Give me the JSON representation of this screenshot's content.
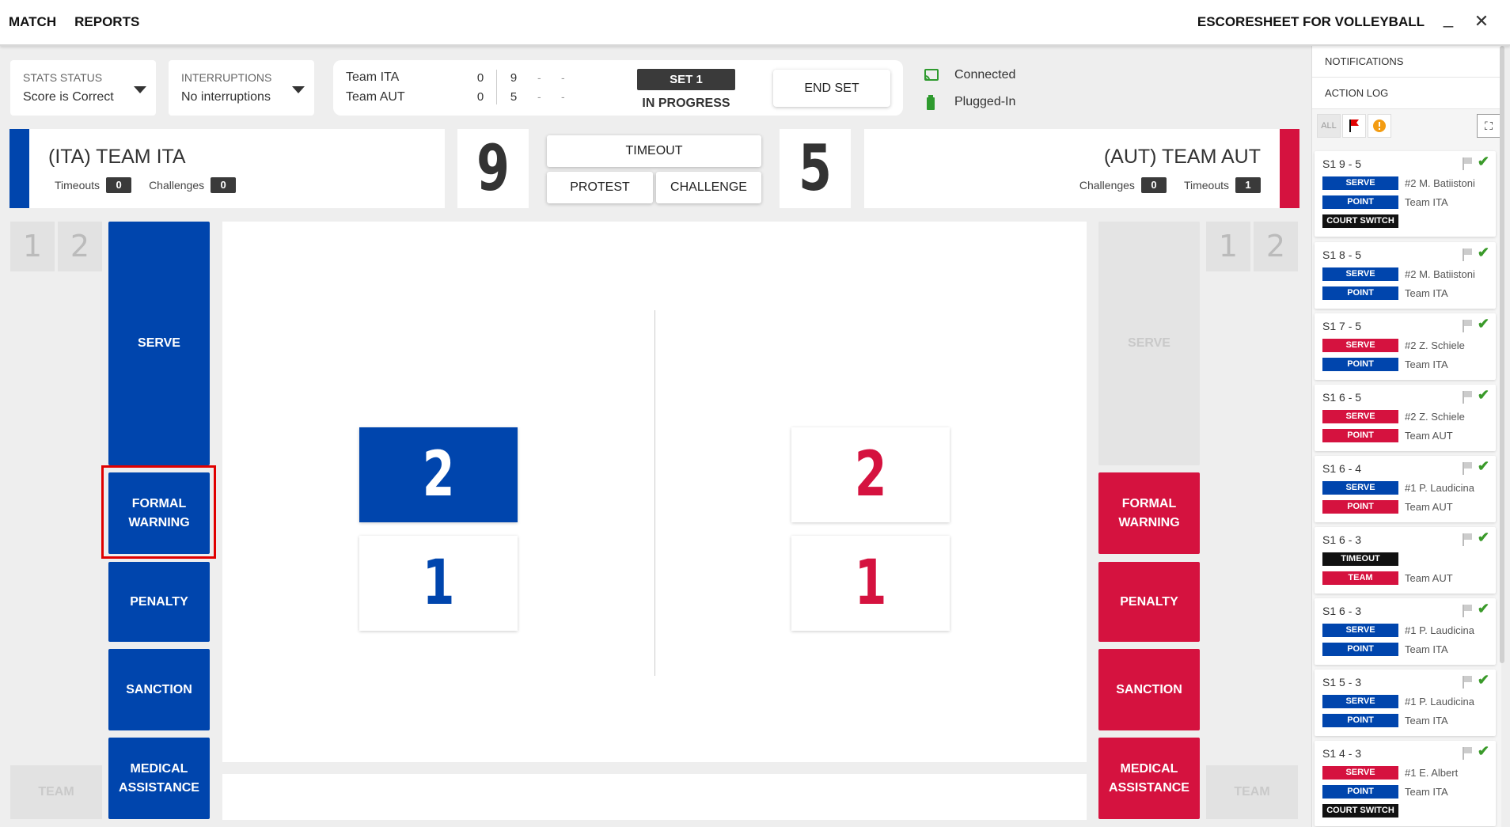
{
  "topbar": {
    "menu": [
      "MATCH",
      "REPORTS"
    ],
    "title": "ESCORESHEET FOR VOLLEYBALL",
    "minimize": "_",
    "close": "✕"
  },
  "status": {
    "stats_label": "STATS STATUS",
    "stats_value": "Score is Correct",
    "interruptions_label": "INTERRUPTIONS",
    "interruptions_value": "No interruptions"
  },
  "scoreboard": {
    "teams": [
      {
        "name": "Team ITA",
        "sets": "0",
        "s1": "9",
        "s2": "-",
        "s3": "-"
      },
      {
        "name": "Team AUT",
        "sets": "0",
        "s1": "5",
        "s2": "-",
        "s3": "-"
      }
    ],
    "set_label": "SET 1",
    "set_state": "IN PROGRESS",
    "end_set": "END SET"
  },
  "connection": {
    "connected": "Connected",
    "power": "Plugged-In",
    "accent": "#2e9a2e"
  },
  "teams": {
    "left": {
      "name": "(ITA) TEAM ITA",
      "timeouts_label": "Timeouts",
      "timeouts": "0",
      "challenges_label": "Challenges",
      "challenges": "0",
      "score": "9",
      "color": "#0045ad"
    },
    "right": {
      "name": "(AUT) TEAM AUT",
      "timeouts_label": "Timeouts",
      "timeouts": "1",
      "challenges_label": "Challenges",
      "challenges": "0",
      "score": "5",
      "color": "#d5123f"
    }
  },
  "center_buttons": {
    "timeout": "TIMEOUT",
    "protest": "PROTEST",
    "challenge": "CHALLENGE"
  },
  "set_tabs": [
    "1",
    "2"
  ],
  "actions": {
    "serve": "SERVE",
    "formal_warning": "FORMAL WARNING",
    "penalty": "PENALTY",
    "sanction": "SANCTION",
    "medical": "MEDICAL ASSISTANCE",
    "team": "TEAM"
  },
  "court": {
    "left": {
      "top": "2",
      "bottom": "1"
    },
    "right": {
      "top": "2",
      "bottom": "1"
    }
  },
  "log": {
    "notifications": "NOTIFICATIONS",
    "action_log": "ACTION LOG",
    "filter_all": "ALL",
    "entries": [
      {
        "header": "S1  9 - 5",
        "lines": [
          {
            "tag": "SERVE",
            "color": "blue",
            "text": "#2 M. Batiistoni"
          },
          {
            "tag": "POINT",
            "color": "blue",
            "text": "Team ITA"
          },
          {
            "tag": "COURT SWITCH",
            "color": "black",
            "text": ""
          }
        ]
      },
      {
        "header": "S1  8 - 5",
        "lines": [
          {
            "tag": "SERVE",
            "color": "blue",
            "text": "#2 M. Batiistoni"
          },
          {
            "tag": "POINT",
            "color": "blue",
            "text": "Team ITA"
          }
        ]
      },
      {
        "header": "S1  7 - 5",
        "lines": [
          {
            "tag": "SERVE",
            "color": "red",
            "text": "#2 Z. Schiele"
          },
          {
            "tag": "POINT",
            "color": "blue",
            "text": "Team ITA"
          }
        ]
      },
      {
        "header": "S1  6 - 5",
        "lines": [
          {
            "tag": "SERVE",
            "color": "red",
            "text": "#2 Z. Schiele"
          },
          {
            "tag": "POINT",
            "color": "red",
            "text": "Team AUT"
          }
        ]
      },
      {
        "header": "S1  6 - 4",
        "lines": [
          {
            "tag": "SERVE",
            "color": "blue",
            "text": "#1 P. Laudicina"
          },
          {
            "tag": "POINT",
            "color": "red",
            "text": "Team AUT"
          }
        ]
      },
      {
        "header": "S1  6 - 3",
        "lines": [
          {
            "tag": "TIMEOUT",
            "color": "black",
            "text": ""
          },
          {
            "tag": "TEAM",
            "color": "red",
            "text": "Team AUT"
          }
        ]
      },
      {
        "header": "S1  6 - 3",
        "lines": [
          {
            "tag": "SERVE",
            "color": "blue",
            "text": "#1 P. Laudicina"
          },
          {
            "tag": "POINT",
            "color": "blue",
            "text": "Team ITA"
          }
        ]
      },
      {
        "header": "S1  5 - 3",
        "lines": [
          {
            "tag": "SERVE",
            "color": "blue",
            "text": "#1 P. Laudicina"
          },
          {
            "tag": "POINT",
            "color": "blue",
            "text": "Team ITA"
          }
        ]
      },
      {
        "header": "S1  4 - 3",
        "lines": [
          {
            "tag": "SERVE",
            "color": "red",
            "text": "#1 E. Albert"
          },
          {
            "tag": "POINT",
            "color": "blue",
            "text": "Team ITA"
          },
          {
            "tag": "COURT SWITCH",
            "color": "black",
            "text": ""
          }
        ]
      }
    ]
  }
}
